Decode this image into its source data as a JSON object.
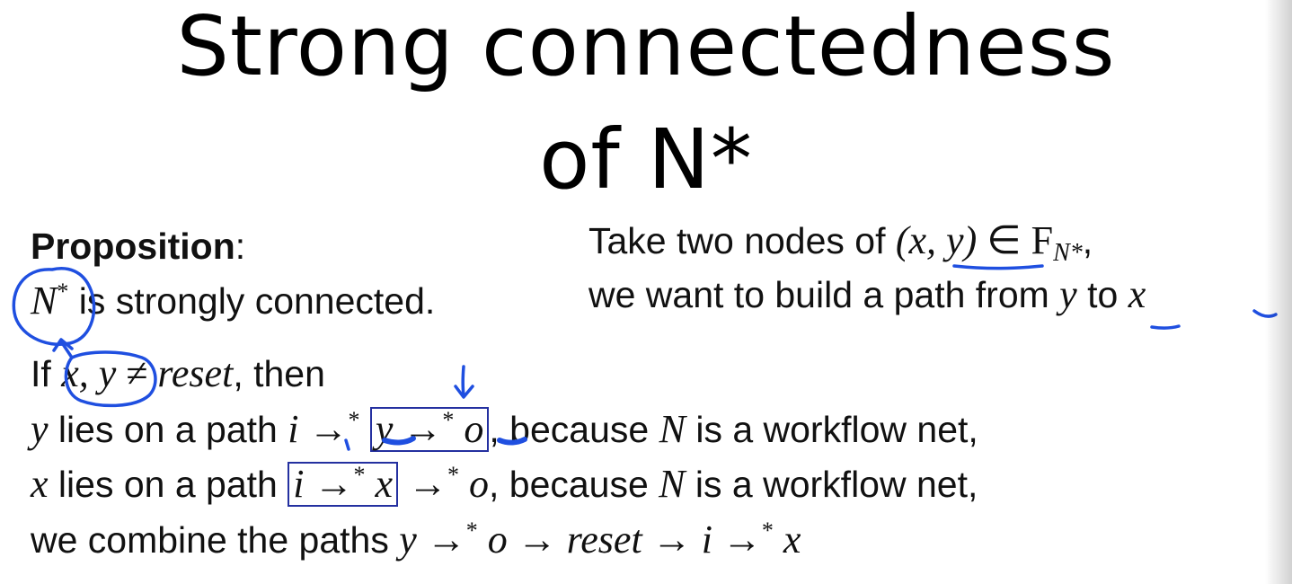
{
  "title": {
    "line1": "Strong connectedness",
    "line2": "of N*"
  },
  "proposition": {
    "heading": "Proposition",
    "colon": ":",
    "subject": "N",
    "subject_sup": "*",
    "statement": " is strongly connected."
  },
  "intro": {
    "text1": "Take two nodes of ",
    "pair": "(x, y)",
    "in_sym": " ∈ F",
    "set_sub": "N*",
    "comma": ",",
    "line2_a": "we want to build a path from ",
    "y": "y",
    "line2_b": " to ",
    "x": "x"
  },
  "proof": {
    "if_word": "If ",
    "if_vars": "x, y",
    "if_neq": " ≠ ",
    "if_reset": "reset",
    "if_then": ", then",
    "l1": {
      "var": "y",
      "text": " lies on a path ",
      "i": "i",
      "arrow1": " →",
      "star1": "*",
      "boxed_y": "y",
      "boxed_arrow": " →",
      "boxed_star": "*",
      "boxed_o": " o",
      "because": ", because ",
      "N": "N",
      "tail": " is a workflow net,"
    },
    "l2": {
      "var": "x",
      "text": " lies on a path ",
      "boxed_i": "i",
      "boxed_arrow": " →",
      "boxed_star": "*",
      "boxed_x": " x",
      "arrow2": " →",
      "star2": "*",
      "o": " o",
      "because": ", because ",
      "N": "N",
      "tail": " is a workflow net,"
    },
    "l3": {
      "text": "we combine the paths ",
      "y": "y",
      "a1": " →",
      "s1": "*",
      "o": " o",
      "a2": " → ",
      "reset": "reset",
      "a3": " → ",
      "i": "i",
      "a4": " →",
      "s4": "*",
      "x": " x"
    }
  },
  "colors": {
    "ink": "#1f4fe0",
    "box": "#2430a0",
    "text": "#111111"
  }
}
